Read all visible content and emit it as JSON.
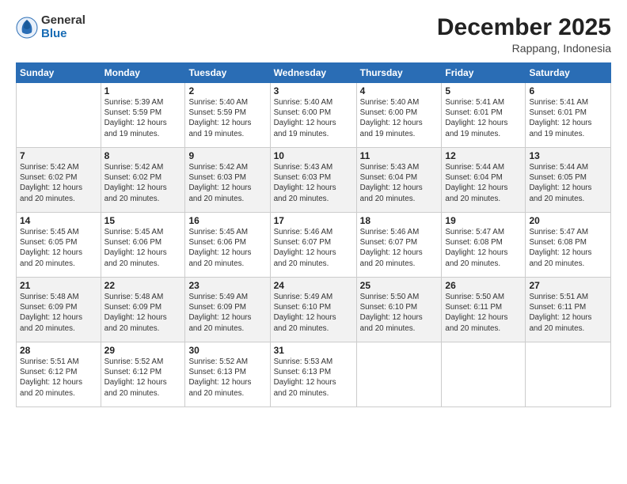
{
  "logo": {
    "general": "General",
    "blue": "Blue"
  },
  "title": "December 2025",
  "location": "Rappang, Indonesia",
  "header_days": [
    "Sunday",
    "Monday",
    "Tuesday",
    "Wednesday",
    "Thursday",
    "Friday",
    "Saturday"
  ],
  "weeks": [
    [
      {
        "num": "",
        "detail": ""
      },
      {
        "num": "1",
        "detail": "Sunrise: 5:39 AM\nSunset: 5:59 PM\nDaylight: 12 hours\nand 19 minutes."
      },
      {
        "num": "2",
        "detail": "Sunrise: 5:40 AM\nSunset: 5:59 PM\nDaylight: 12 hours\nand 19 minutes."
      },
      {
        "num": "3",
        "detail": "Sunrise: 5:40 AM\nSunset: 6:00 PM\nDaylight: 12 hours\nand 19 minutes."
      },
      {
        "num": "4",
        "detail": "Sunrise: 5:40 AM\nSunset: 6:00 PM\nDaylight: 12 hours\nand 19 minutes."
      },
      {
        "num": "5",
        "detail": "Sunrise: 5:41 AM\nSunset: 6:01 PM\nDaylight: 12 hours\nand 19 minutes."
      },
      {
        "num": "6",
        "detail": "Sunrise: 5:41 AM\nSunset: 6:01 PM\nDaylight: 12 hours\nand 19 minutes."
      }
    ],
    [
      {
        "num": "7",
        "detail": "Sunrise: 5:42 AM\nSunset: 6:02 PM\nDaylight: 12 hours\nand 20 minutes."
      },
      {
        "num": "8",
        "detail": "Sunrise: 5:42 AM\nSunset: 6:02 PM\nDaylight: 12 hours\nand 20 minutes."
      },
      {
        "num": "9",
        "detail": "Sunrise: 5:42 AM\nSunset: 6:03 PM\nDaylight: 12 hours\nand 20 minutes."
      },
      {
        "num": "10",
        "detail": "Sunrise: 5:43 AM\nSunset: 6:03 PM\nDaylight: 12 hours\nand 20 minutes."
      },
      {
        "num": "11",
        "detail": "Sunrise: 5:43 AM\nSunset: 6:04 PM\nDaylight: 12 hours\nand 20 minutes."
      },
      {
        "num": "12",
        "detail": "Sunrise: 5:44 AM\nSunset: 6:04 PM\nDaylight: 12 hours\nand 20 minutes."
      },
      {
        "num": "13",
        "detail": "Sunrise: 5:44 AM\nSunset: 6:05 PM\nDaylight: 12 hours\nand 20 minutes."
      }
    ],
    [
      {
        "num": "14",
        "detail": "Sunrise: 5:45 AM\nSunset: 6:05 PM\nDaylight: 12 hours\nand 20 minutes."
      },
      {
        "num": "15",
        "detail": "Sunrise: 5:45 AM\nSunset: 6:06 PM\nDaylight: 12 hours\nand 20 minutes."
      },
      {
        "num": "16",
        "detail": "Sunrise: 5:45 AM\nSunset: 6:06 PM\nDaylight: 12 hours\nand 20 minutes."
      },
      {
        "num": "17",
        "detail": "Sunrise: 5:46 AM\nSunset: 6:07 PM\nDaylight: 12 hours\nand 20 minutes."
      },
      {
        "num": "18",
        "detail": "Sunrise: 5:46 AM\nSunset: 6:07 PM\nDaylight: 12 hours\nand 20 minutes."
      },
      {
        "num": "19",
        "detail": "Sunrise: 5:47 AM\nSunset: 6:08 PM\nDaylight: 12 hours\nand 20 minutes."
      },
      {
        "num": "20",
        "detail": "Sunrise: 5:47 AM\nSunset: 6:08 PM\nDaylight: 12 hours\nand 20 minutes."
      }
    ],
    [
      {
        "num": "21",
        "detail": "Sunrise: 5:48 AM\nSunset: 6:09 PM\nDaylight: 12 hours\nand 20 minutes."
      },
      {
        "num": "22",
        "detail": "Sunrise: 5:48 AM\nSunset: 6:09 PM\nDaylight: 12 hours\nand 20 minutes."
      },
      {
        "num": "23",
        "detail": "Sunrise: 5:49 AM\nSunset: 6:09 PM\nDaylight: 12 hours\nand 20 minutes."
      },
      {
        "num": "24",
        "detail": "Sunrise: 5:49 AM\nSunset: 6:10 PM\nDaylight: 12 hours\nand 20 minutes."
      },
      {
        "num": "25",
        "detail": "Sunrise: 5:50 AM\nSunset: 6:10 PM\nDaylight: 12 hours\nand 20 minutes."
      },
      {
        "num": "26",
        "detail": "Sunrise: 5:50 AM\nSunset: 6:11 PM\nDaylight: 12 hours\nand 20 minutes."
      },
      {
        "num": "27",
        "detail": "Sunrise: 5:51 AM\nSunset: 6:11 PM\nDaylight: 12 hours\nand 20 minutes."
      }
    ],
    [
      {
        "num": "28",
        "detail": "Sunrise: 5:51 AM\nSunset: 6:12 PM\nDaylight: 12 hours\nand 20 minutes."
      },
      {
        "num": "29",
        "detail": "Sunrise: 5:52 AM\nSunset: 6:12 PM\nDaylight: 12 hours\nand 20 minutes."
      },
      {
        "num": "30",
        "detail": "Sunrise: 5:52 AM\nSunset: 6:13 PM\nDaylight: 12 hours\nand 20 minutes."
      },
      {
        "num": "31",
        "detail": "Sunrise: 5:53 AM\nSunset: 6:13 PM\nDaylight: 12 hours\nand 20 minutes."
      },
      {
        "num": "",
        "detail": ""
      },
      {
        "num": "",
        "detail": ""
      },
      {
        "num": "",
        "detail": ""
      }
    ]
  ]
}
